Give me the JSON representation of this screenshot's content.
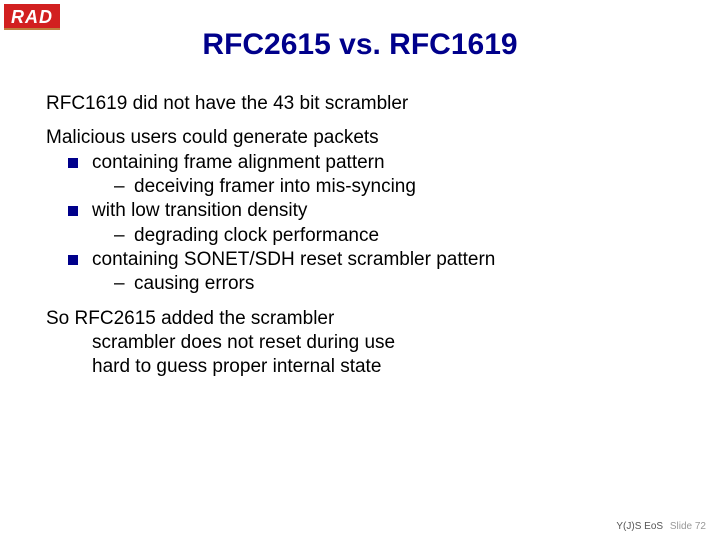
{
  "logo": {
    "text": "RAD"
  },
  "title": "RFC2615 vs. RFC1619",
  "body": {
    "p1": "RFC1619 did not have the 43 bit scrambler",
    "p2_intro": "Malicious users could generate packets",
    "b1": "containing frame alignment pattern",
    "b1_sub": "deceiving framer into mis-syncing",
    "b2": "with low transition density",
    "b2_sub": "degrading clock performance",
    "b3": "containing SONET/SDH reset scrambler pattern",
    "b3_sub": "causing errors",
    "p3_l1": "So RFC2615 added the scrambler",
    "p3_l2": "scrambler does not reset during use",
    "p3_l3": "hard to guess proper internal state"
  },
  "footer": {
    "label": "Y(J)S EoS",
    "slide": "Slide 72"
  }
}
